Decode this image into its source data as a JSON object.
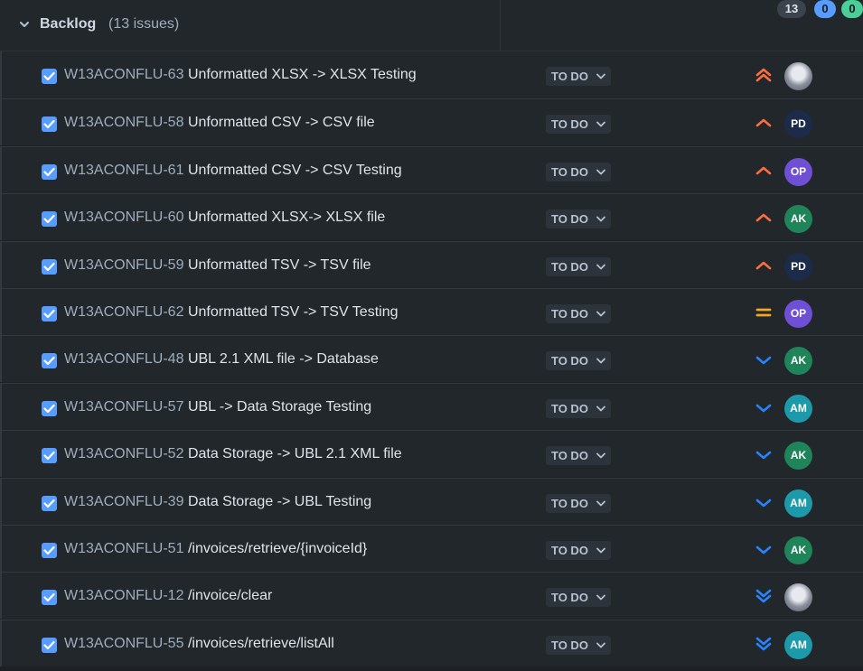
{
  "backlog": {
    "title": "Backlog",
    "count_label": "(13 issues)",
    "badges": {
      "total": "13",
      "in_progress": "0",
      "done": "0"
    }
  },
  "colors": {
    "priority_high": "#fc6d3f",
    "priority_medium": "#f5a623",
    "priority_low": "#2684ff",
    "checkbox": "#579dff"
  },
  "issues": [
    {
      "key": "W13ACONFLU-63",
      "summary": "Unformatted XLSX -> XLSX Testing",
      "status": "TO DO",
      "priority": "highest",
      "assignee": "",
      "avatar_color": ""
    },
    {
      "key": "W13ACONFLU-58",
      "summary": "Unformatted CSV -> CSV file",
      "status": "TO DO",
      "priority": "high",
      "assignee": "PD",
      "avatar_color": "#1c2b4a"
    },
    {
      "key": "W13ACONFLU-61",
      "summary": "Unformatted CSV -> CSV Testing",
      "status": "TO DO",
      "priority": "high",
      "assignee": "OP",
      "avatar_color": "#6e4fd6"
    },
    {
      "key": "W13ACONFLU-60",
      "summary": "Unformatted XLSX-> XLSX file",
      "status": "TO DO",
      "priority": "high",
      "assignee": "AK",
      "avatar_color": "#1f845a"
    },
    {
      "key": "W13ACONFLU-59",
      "summary": "Unformatted TSV -> TSV file",
      "status": "TO DO",
      "priority": "high",
      "assignee": "PD",
      "avatar_color": "#1c2b4a"
    },
    {
      "key": "W13ACONFLU-62",
      "summary": "Unformatted TSV -> TSV Testing",
      "status": "TO DO",
      "priority": "medium",
      "assignee": "OP",
      "avatar_color": "#6e4fd6"
    },
    {
      "key": "W13ACONFLU-48",
      "summary": "UBL 2.1 XML file -> Database",
      "status": "TO DO",
      "priority": "low",
      "assignee": "AK",
      "avatar_color": "#1f845a"
    },
    {
      "key": "W13ACONFLU-57",
      "summary": "UBL -> Data Storage Testing",
      "status": "TO DO",
      "priority": "low",
      "assignee": "AM",
      "avatar_color": "#1d9aaa"
    },
    {
      "key": "W13ACONFLU-52",
      "summary": "Data Storage -> UBL 2.1 XML file",
      "status": "TO DO",
      "priority": "low",
      "assignee": "AK",
      "avatar_color": "#1f845a"
    },
    {
      "key": "W13ACONFLU-39",
      "summary": "Data Storage -> UBL Testing",
      "status": "TO DO",
      "priority": "low",
      "assignee": "AM",
      "avatar_color": "#1d9aaa"
    },
    {
      "key": "W13ACONFLU-51",
      "summary": "/invoices/retrieve/{invoiceId}",
      "status": "TO DO",
      "priority": "low",
      "assignee": "AK",
      "avatar_color": "#1f845a"
    },
    {
      "key": "W13ACONFLU-12",
      "summary": "/invoice/clear",
      "status": "TO DO",
      "priority": "lowest",
      "assignee": "",
      "avatar_color": ""
    },
    {
      "key": "W13ACONFLU-55",
      "summary": "/invoices/retrieve/listAll",
      "status": "TO DO",
      "priority": "lowest",
      "assignee": "AM",
      "avatar_color": "#1d9aaa"
    }
  ]
}
